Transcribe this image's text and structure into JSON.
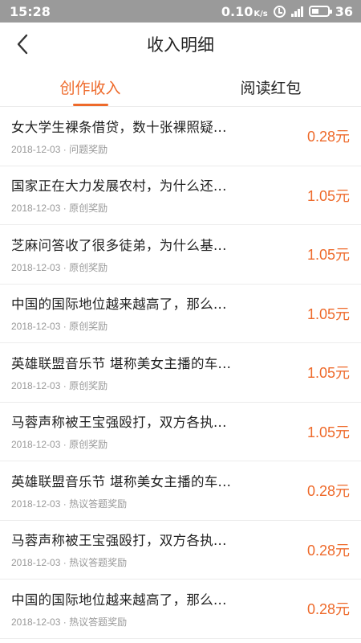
{
  "status_bar": {
    "time": "15:28",
    "net_speed": "0.10",
    "net_unit": "K/s",
    "battery": "36"
  },
  "header": {
    "title": "收入明细"
  },
  "tabs": [
    {
      "label": "创作收入",
      "active": true
    },
    {
      "label": "阅读红包",
      "active": false
    }
  ],
  "colors": {
    "accent": "#ee6a2b",
    "status_bar": "#9a9a9a"
  },
  "rows": [
    {
      "title": "女大学生裸条借贷，数十张裸照疑...",
      "date": "2018-12-03",
      "type": "问题奖励",
      "amount": "0.28元"
    },
    {
      "title": "国家正在大力发展农村，为什么还...",
      "date": "2018-12-03",
      "type": "原创奖励",
      "amount": "1.05元"
    },
    {
      "title": "芝麻问答收了很多徒弟，为什么基...",
      "date": "2018-12-03",
      "type": "原创奖励",
      "amount": "1.05元"
    },
    {
      "title": "中国的国际地位越来越高了，那么...",
      "date": "2018-12-03",
      "type": "原创奖励",
      "amount": "1.05元"
    },
    {
      "title": "英雄联盟音乐节 堪称美女主播的车...",
      "date": "2018-12-03",
      "type": "原创奖励",
      "amount": "1.05元"
    },
    {
      "title": "马蓉声称被王宝强殴打，双方各执...",
      "date": "2018-12-03",
      "type": "原创奖励",
      "amount": "1.05元"
    },
    {
      "title": "英雄联盟音乐节 堪称美女主播的车...",
      "date": "2018-12-03",
      "type": "热议答题奖励",
      "amount": "0.28元"
    },
    {
      "title": "马蓉声称被王宝强殴打，双方各执...",
      "date": "2018-12-03",
      "type": "热议答题奖励",
      "amount": "0.28元"
    },
    {
      "title": "中国的国际地位越来越高了，那么...",
      "date": "2018-12-03",
      "type": "热议答题奖励",
      "amount": "0.28元"
    }
  ]
}
